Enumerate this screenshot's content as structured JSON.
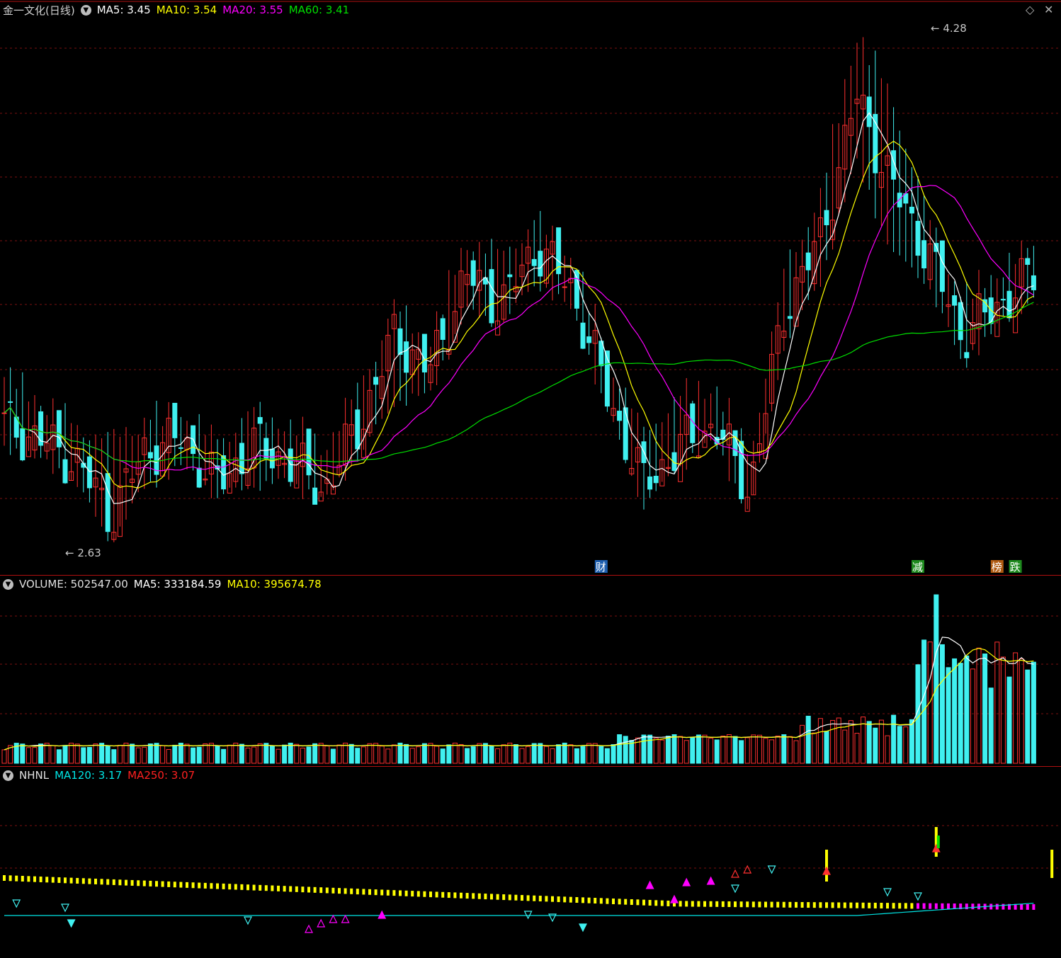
{
  "price_panel": {
    "title": "金一文化(日线)",
    "ma_labels": [
      {
        "text": "MA5: 3.45",
        "color": "#ffffff"
      },
      {
        "text": "MA10: 3.54",
        "color": "#ffff00"
      },
      {
        "text": "MA20: 3.55",
        "color": "#ff00ff"
      },
      {
        "text": "MA60: 3.41",
        "color": "#00e000"
      }
    ],
    "high_marker": "4.28",
    "low_marker": "2.63",
    "event_tags": [
      {
        "text": "财",
        "bg": "#1e5fb0",
        "idx": 98
      },
      {
        "text": "减",
        "bg": "#1e8a1e",
        "idx": 150
      },
      {
        "text": "榜",
        "bg": "#b05a10",
        "idx": 163
      },
      {
        "text": "跌",
        "bg": "#1e8a1e",
        "idx": 166
      }
    ]
  },
  "volume_panel": {
    "title": "VOLUME: 502547.00",
    "labels": [
      {
        "text": "MA5: 333184.59",
        "color": "#ffffff"
      },
      {
        "text": "MA10: 395674.78",
        "color": "#ffff00"
      }
    ]
  },
  "nhnl_panel": {
    "title": "NHNL",
    "labels": [
      {
        "text": "MA120: 3.17",
        "color": "#00e5e5"
      },
      {
        "text": "MA250: 3.07",
        "color": "#ff2020"
      }
    ]
  },
  "corner_icons": [
    "diamond-icon",
    "close-icon"
  ],
  "colors": {
    "up": "#ff3030",
    "down": "#40f0f0",
    "grid": "#7a1010",
    "ma5": "#ffffff",
    "ma10": "#ffff00",
    "ma20": "#ff00ff",
    "ma60": "#00e000"
  },
  "chart_data": [
    {
      "type": "candlestick",
      "ylim": [
        2.55,
        4.35
      ],
      "y_high": 4.28,
      "y_low": 2.63,
      "keys": [
        {
          "close": 3.0,
          "hi": 3.12,
          "lo": 2.95
        },
        {
          "close": 2.95,
          "hi": 3.05,
          "lo": 2.9
        },
        {
          "close": 2.88,
          "hi": 2.95,
          "lo": 2.83
        },
        {
          "close": 2.7,
          "hi": 2.9,
          "lo": 2.63
        },
        {
          "close": 2.92,
          "hi": 2.98,
          "lo": 2.82
        },
        {
          "close": 2.95,
          "hi": 3.0,
          "lo": 2.88
        },
        {
          "close": 2.8,
          "hi": 2.9,
          "lo": 2.78
        },
        {
          "close": 2.93,
          "hi": 3.0,
          "lo": 2.82
        },
        {
          "close": 2.88,
          "hi": 2.96,
          "lo": 2.83
        },
        {
          "close": 2.78,
          "hi": 2.88,
          "lo": 2.76
        },
        {
          "close": 3.0,
          "hi": 3.08,
          "lo": 2.92
        },
        {
          "close": 3.3,
          "hi": 3.35,
          "lo": 3.1
        },
        {
          "close": 3.18,
          "hi": 3.24,
          "lo": 3.12
        },
        {
          "close": 3.5,
          "hi": 3.58,
          "lo": 3.4
        },
        {
          "close": 3.4,
          "hi": 3.52,
          "lo": 3.36
        },
        {
          "close": 3.6,
          "hi": 3.64,
          "lo": 3.5
        },
        {
          "close": 3.45,
          "hi": 3.52,
          "lo": 3.4
        },
        {
          "close": 3.1,
          "hi": 3.2,
          "lo": 3.06
        },
        {
          "close": 2.8,
          "hi": 2.92,
          "lo": 2.75
        },
        {
          "close": 2.92,
          "hi": 3.05,
          "lo": 2.88
        },
        {
          "close": 3.0,
          "hi": 3.1,
          "lo": 2.96
        },
        {
          "close": 2.78,
          "hi": 2.85,
          "lo": 2.72
        },
        {
          "close": 3.4,
          "hi": 3.48,
          "lo": 3.3
        },
        {
          "close": 3.62,
          "hi": 3.72,
          "lo": 3.5
        },
        {
          "close": 4.1,
          "hi": 4.28,
          "lo": 3.9
        },
        {
          "close": 3.8,
          "hi": 4.05,
          "lo": 3.6
        },
        {
          "close": 3.58,
          "hi": 3.66,
          "lo": 3.5
        },
        {
          "close": 3.3,
          "hi": 3.38,
          "lo": 3.22
        },
        {
          "close": 3.4,
          "hi": 3.48,
          "lo": 3.35
        },
        {
          "close": 3.5,
          "hi": 3.55,
          "lo": 3.45
        }
      ]
    },
    {
      "type": "bar",
      "title": "VOLUME",
      "note": "volume bars with MA5 and MA10 lines; latest 502547.00"
    },
    {
      "type": "line",
      "title": "NHNL",
      "series": [
        {
          "name": "MA120",
          "last": 3.17
        },
        {
          "name": "MA250",
          "last": 3.07
        }
      ]
    }
  ]
}
